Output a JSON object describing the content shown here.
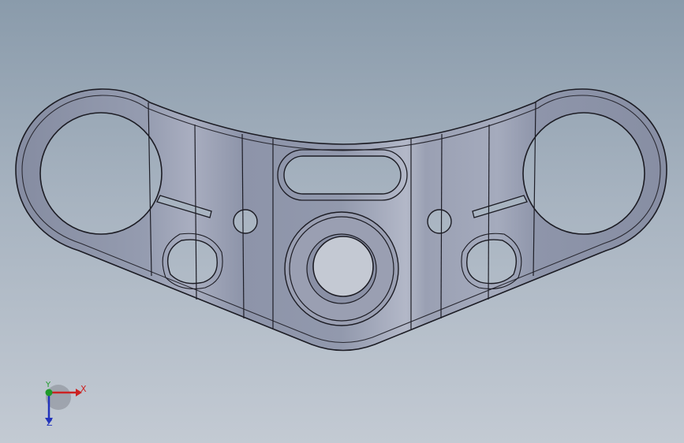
{
  "view": {
    "background_top": "#8a9bab",
    "background_bottom": "#c3cad3"
  },
  "part": {
    "body_color": "#9097ab",
    "highlight_color": "#b7bccb",
    "edge_color": "#1c1c24"
  },
  "triad": {
    "x_label": "X",
    "y_label": "Y",
    "z_label": "Z",
    "x_color": "#cc2222",
    "y_color": "#1e9a2a",
    "z_color": "#2233bb"
  }
}
